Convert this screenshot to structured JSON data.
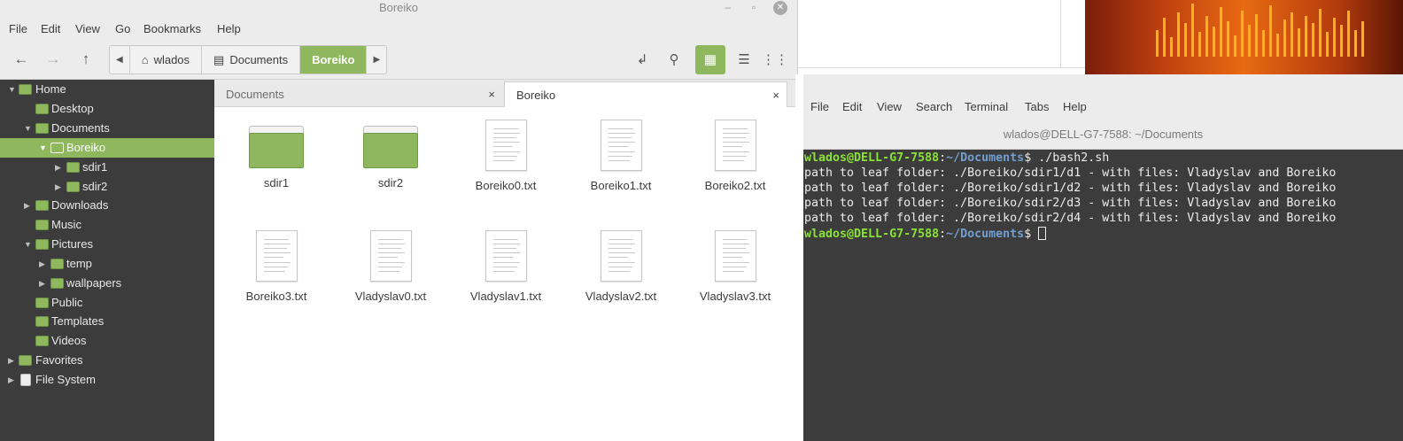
{
  "file_manager": {
    "title": "Boreiko",
    "menu": [
      "File",
      "Edit",
      "View",
      "Go",
      "Bookmarks",
      "Help"
    ],
    "breadcrumbs": [
      "wlados",
      "Documents",
      "Boreiko"
    ],
    "sidebar": [
      {
        "label": "Home"
      },
      {
        "label": "Desktop"
      },
      {
        "label": "Documents"
      },
      {
        "label": "Boreiko"
      },
      {
        "label": "sdir1"
      },
      {
        "label": "sdir2"
      },
      {
        "label": "Downloads"
      },
      {
        "label": "Music"
      },
      {
        "label": "Pictures"
      },
      {
        "label": "temp"
      },
      {
        "label": "wallpapers"
      },
      {
        "label": "Public"
      },
      {
        "label": "Templates"
      },
      {
        "label": "Videos"
      },
      {
        "label": "Favorites"
      },
      {
        "label": "File System"
      }
    ],
    "tabs": [
      {
        "label": "Documents",
        "close": "×"
      },
      {
        "label": "Boreiko",
        "close": "×"
      }
    ],
    "items": [
      {
        "name": "sdir1",
        "kind": "folder"
      },
      {
        "name": "sdir2",
        "kind": "folder"
      },
      {
        "name": "Boreiko0.txt",
        "kind": "text"
      },
      {
        "name": "Boreiko1.txt",
        "kind": "text"
      },
      {
        "name": "Boreiko2.txt",
        "kind": "text"
      },
      {
        "name": "Boreiko3.txt",
        "kind": "text"
      },
      {
        "name": "Vladyslav0.txt",
        "kind": "text"
      },
      {
        "name": "Vladyslav1.txt",
        "kind": "text"
      },
      {
        "name": "Vladyslav2.txt",
        "kind": "text"
      },
      {
        "name": "Vladyslav3.txt",
        "kind": "text"
      }
    ],
    "accent_color": "#8fb85e"
  },
  "terminal": {
    "title": "wlados@DELL-G7-7588: ~/Documents",
    "menu": [
      "File",
      "Edit",
      "View",
      "Search",
      "Terminal",
      "Tabs",
      "Help"
    ],
    "prompt_user": "wlados@DELL-G7-7588",
    "prompt_path": "~/Documents",
    "command": "./bash2.sh",
    "output": [
      "path to leaf folder: ./Boreiko/sdir1/d1 - with files: Vladyslav and Boreiko",
      "path to leaf folder: ./Boreiko/sdir1/d2 - with files: Vladyslav and Boreiko",
      "path to leaf folder: ./Boreiko/sdir2/d3 - with files: Vladyslav and Boreiko",
      "path to leaf folder: ./Boreiko/sdir2/d4 - with files: Vladyslav and Boreiko"
    ],
    "user_color": "#8ae234",
    "path_color": "#729fcf"
  }
}
